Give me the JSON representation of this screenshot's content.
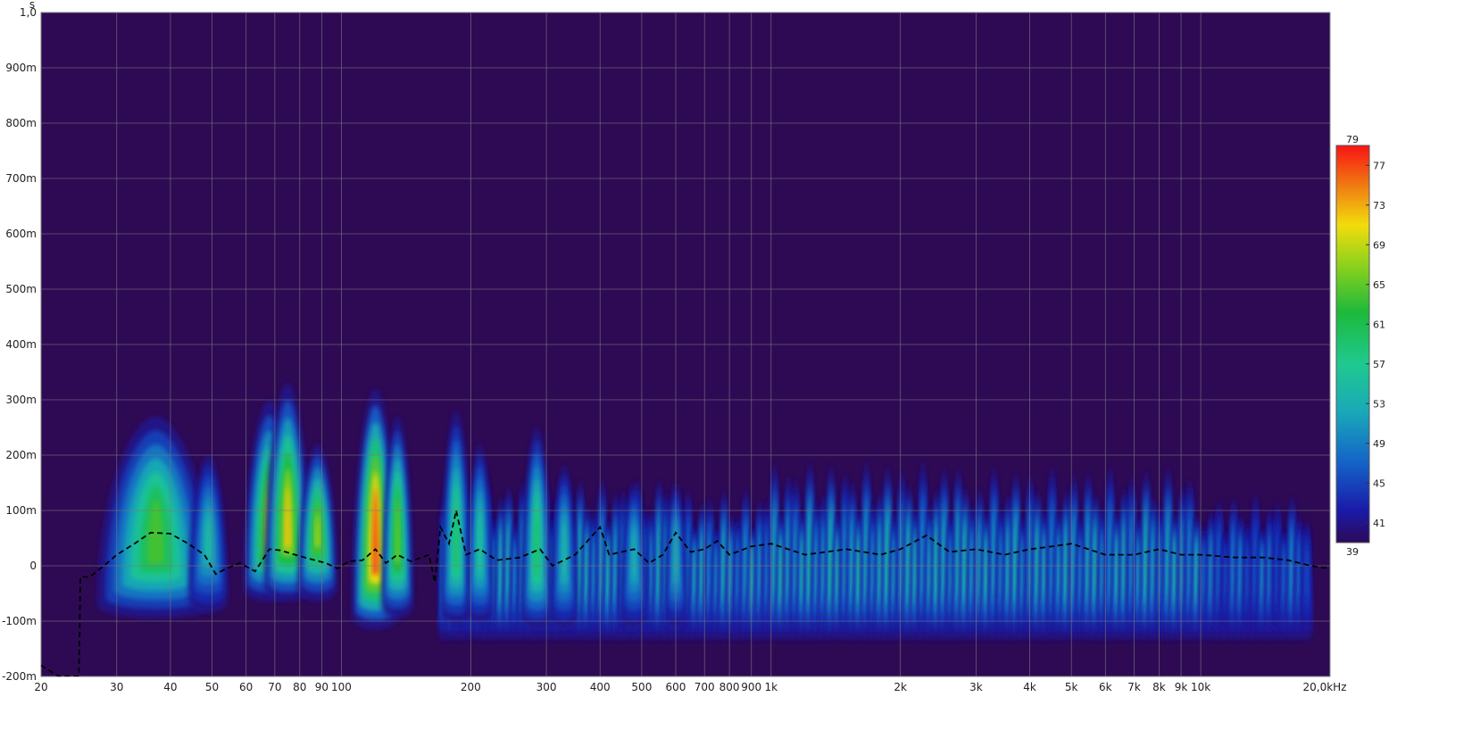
{
  "chart_data": {
    "type": "heatmap",
    "y_unit": "s",
    "x_unit_label": "20,0kHz",
    "x_scale": "log",
    "x_range": [
      20,
      20000
    ],
    "y_range": [
      -0.2,
      1.0
    ],
    "grid": true,
    "y_ticks": [
      {
        "value": 1.0,
        "label": "1,0"
      },
      {
        "value": 0.9,
        "label": "900m"
      },
      {
        "value": 0.8,
        "label": "800m"
      },
      {
        "value": 0.7,
        "label": "700m"
      },
      {
        "value": 0.6,
        "label": "600m"
      },
      {
        "value": 0.5,
        "label": "500m"
      },
      {
        "value": 0.4,
        "label": "400m"
      },
      {
        "value": 0.3,
        "label": "300m"
      },
      {
        "value": 0.2,
        "label": "200m"
      },
      {
        "value": 0.1,
        "label": "100m"
      },
      {
        "value": 0.0,
        "label": "0"
      },
      {
        "value": -0.1,
        "label": "-100m"
      },
      {
        "value": -0.2,
        "label": "-200m"
      }
    ],
    "x_ticks": [
      {
        "value": 20,
        "label": "20"
      },
      {
        "value": 30,
        "label": "30"
      },
      {
        "value": 40,
        "label": "40"
      },
      {
        "value": 50,
        "label": "50"
      },
      {
        "value": 60,
        "label": "60"
      },
      {
        "value": 70,
        "label": "70"
      },
      {
        "value": 80,
        "label": "80"
      },
      {
        "value": 90,
        "label": "90"
      },
      {
        "value": 100,
        "label": "100"
      },
      {
        "value": 200,
        "label": "200"
      },
      {
        "value": 300,
        "label": "300"
      },
      {
        "value": 400,
        "label": "400"
      },
      {
        "value": 500,
        "label": "500"
      },
      {
        "value": 600,
        "label": "600"
      },
      {
        "value": 700,
        "label": "700"
      },
      {
        "value": 800,
        "label": "800"
      },
      {
        "value": 900,
        "label": "900"
      },
      {
        "value": 1000,
        "label": "1k"
      },
      {
        "value": 2000,
        "label": "2k"
      },
      {
        "value": 3000,
        "label": "3k"
      },
      {
        "value": 4000,
        "label": "4k"
      },
      {
        "value": 5000,
        "label": "5k"
      },
      {
        "value": 6000,
        "label": "6k"
      },
      {
        "value": 7000,
        "label": "7k"
      },
      {
        "value": 8000,
        "label": "8k"
      },
      {
        "value": 9000,
        "label": "9k"
      },
      {
        "value": 10000,
        "label": "10k"
      }
    ],
    "colorbar": {
      "min": 39,
      "max": 79,
      "min_label": "39",
      "max_label": "79",
      "ticks": [
        41,
        45,
        49,
        53,
        57,
        61,
        65,
        69,
        73,
        77
      ]
    },
    "energy_blobs": [
      {
        "f": 37,
        "t": 0.02,
        "peak_t": 0.27,
        "width_oct": 0.45,
        "level": 64
      },
      {
        "f": 49,
        "t": 0.03,
        "peak_t": 0.2,
        "width_oct": 0.15,
        "level": 55
      },
      {
        "f": 68,
        "t": 0.05,
        "peak_t": 0.3,
        "width_oct": 0.2,
        "level": 70
      },
      {
        "f": 75,
        "t": 0.05,
        "peak_t": 0.33,
        "width_oct": 0.18,
        "level": 72
      },
      {
        "f": 88,
        "t": 0.05,
        "peak_t": 0.22,
        "width_oct": 0.15,
        "level": 68
      },
      {
        "f": 120,
        "t": 0.0,
        "peak_t": 0.32,
        "width_oct": 0.18,
        "level": 77
      },
      {
        "f": 135,
        "t": 0.02,
        "peak_t": 0.27,
        "width_oct": 0.12,
        "level": 66
      },
      {
        "f": 185,
        "t": 0.01,
        "peak_t": 0.28,
        "width_oct": 0.12,
        "level": 60
      },
      {
        "f": 210,
        "t": 0.01,
        "peak_t": 0.22,
        "width_oct": 0.1,
        "level": 57
      },
      {
        "f": 285,
        "t": 0.0,
        "peak_t": 0.25,
        "width_oct": 0.12,
        "level": 60
      },
      {
        "f": 330,
        "t": 0.0,
        "peak_t": 0.18,
        "width_oct": 0.1,
        "level": 55
      },
      {
        "f": 480,
        "t": 0.0,
        "peak_t": 0.15,
        "width_oct": 0.1,
        "level": 54
      },
      {
        "f": 600,
        "t": 0.0,
        "peak_t": 0.15,
        "width_oct": 0.08,
        "level": 54
      }
    ],
    "band_regions": [
      {
        "f_start": 170,
        "f_end": 560,
        "peak_t": 0.16,
        "level": 57
      },
      {
        "f_start": 560,
        "f_end": 1000,
        "peak_t": 0.14,
        "level": 56
      },
      {
        "f_start": 1000,
        "f_end": 3000,
        "peak_t": 0.19,
        "level": 58
      },
      {
        "f_start": 3000,
        "f_end": 10000,
        "peak_t": 0.18,
        "level": 57
      },
      {
        "f_start": 10000,
        "f_end": 18000,
        "peak_t": 0.13,
        "level": 52
      }
    ],
    "dashed_series": {
      "style": "dashed",
      "color": "#000000",
      "points": [
        [
          20,
          -0.18
        ],
        [
          22,
          -0.2
        ],
        [
          24.5,
          -0.2
        ],
        [
          24.7,
          -0.02
        ],
        [
          26,
          -0.02
        ],
        [
          28,
          0.0
        ],
        [
          30,
          0.02
        ],
        [
          33,
          0.04
        ],
        [
          36,
          0.06
        ],
        [
          40,
          0.058
        ],
        [
          44,
          0.04
        ],
        [
          48,
          0.02
        ],
        [
          51,
          -0.015
        ],
        [
          54,
          -0.005
        ],
        [
          58,
          0.005
        ],
        [
          63,
          -0.01
        ],
        [
          68,
          0.03
        ],
        [
          72,
          0.028
        ],
        [
          78,
          0.02
        ],
        [
          85,
          0.012
        ],
        [
          92,
          0.005
        ],
        [
          98,
          -0.005
        ],
        [
          104,
          0.008
        ],
        [
          112,
          0.01
        ],
        [
          120,
          0.03
        ],
        [
          127,
          0.005
        ],
        [
          135,
          0.02
        ],
        [
          145,
          0.008
        ],
        [
          160,
          0.02
        ],
        [
          165,
          -0.03
        ],
        [
          170,
          0.07
        ],
        [
          178,
          0.04
        ],
        [
          185,
          0.1
        ],
        [
          195,
          0.02
        ],
        [
          210,
          0.03
        ],
        [
          230,
          0.01
        ],
        [
          260,
          0.015
        ],
        [
          290,
          0.03
        ],
        [
          310,
          0.0
        ],
        [
          350,
          0.02
        ],
        [
          400,
          0.07
        ],
        [
          420,
          0.02
        ],
        [
          480,
          0.03
        ],
        [
          520,
          0.005
        ],
        [
          560,
          0.02
        ],
        [
          600,
          0.06
        ],
        [
          650,
          0.025
        ],
        [
          700,
          0.03
        ],
        [
          750,
          0.045
        ],
        [
          800,
          0.02
        ],
        [
          900,
          0.035
        ],
        [
          1000,
          0.04
        ],
        [
          1200,
          0.02
        ],
        [
          1500,
          0.03
        ],
        [
          1800,
          0.02
        ],
        [
          2000,
          0.03
        ],
        [
          2300,
          0.055
        ],
        [
          2600,
          0.025
        ],
        [
          3000,
          0.03
        ],
        [
          3500,
          0.02
        ],
        [
          4000,
          0.03
        ],
        [
          4500,
          0.035
        ],
        [
          5000,
          0.04
        ],
        [
          6000,
          0.02
        ],
        [
          7000,
          0.02
        ],
        [
          8000,
          0.03
        ],
        [
          9000,
          0.02
        ],
        [
          10000,
          0.02
        ],
        [
          12000,
          0.015
        ],
        [
          14000,
          0.015
        ],
        [
          16000,
          0.01
        ],
        [
          18000,
          0.0
        ],
        [
          20000,
          -0.005
        ]
      ]
    }
  }
}
